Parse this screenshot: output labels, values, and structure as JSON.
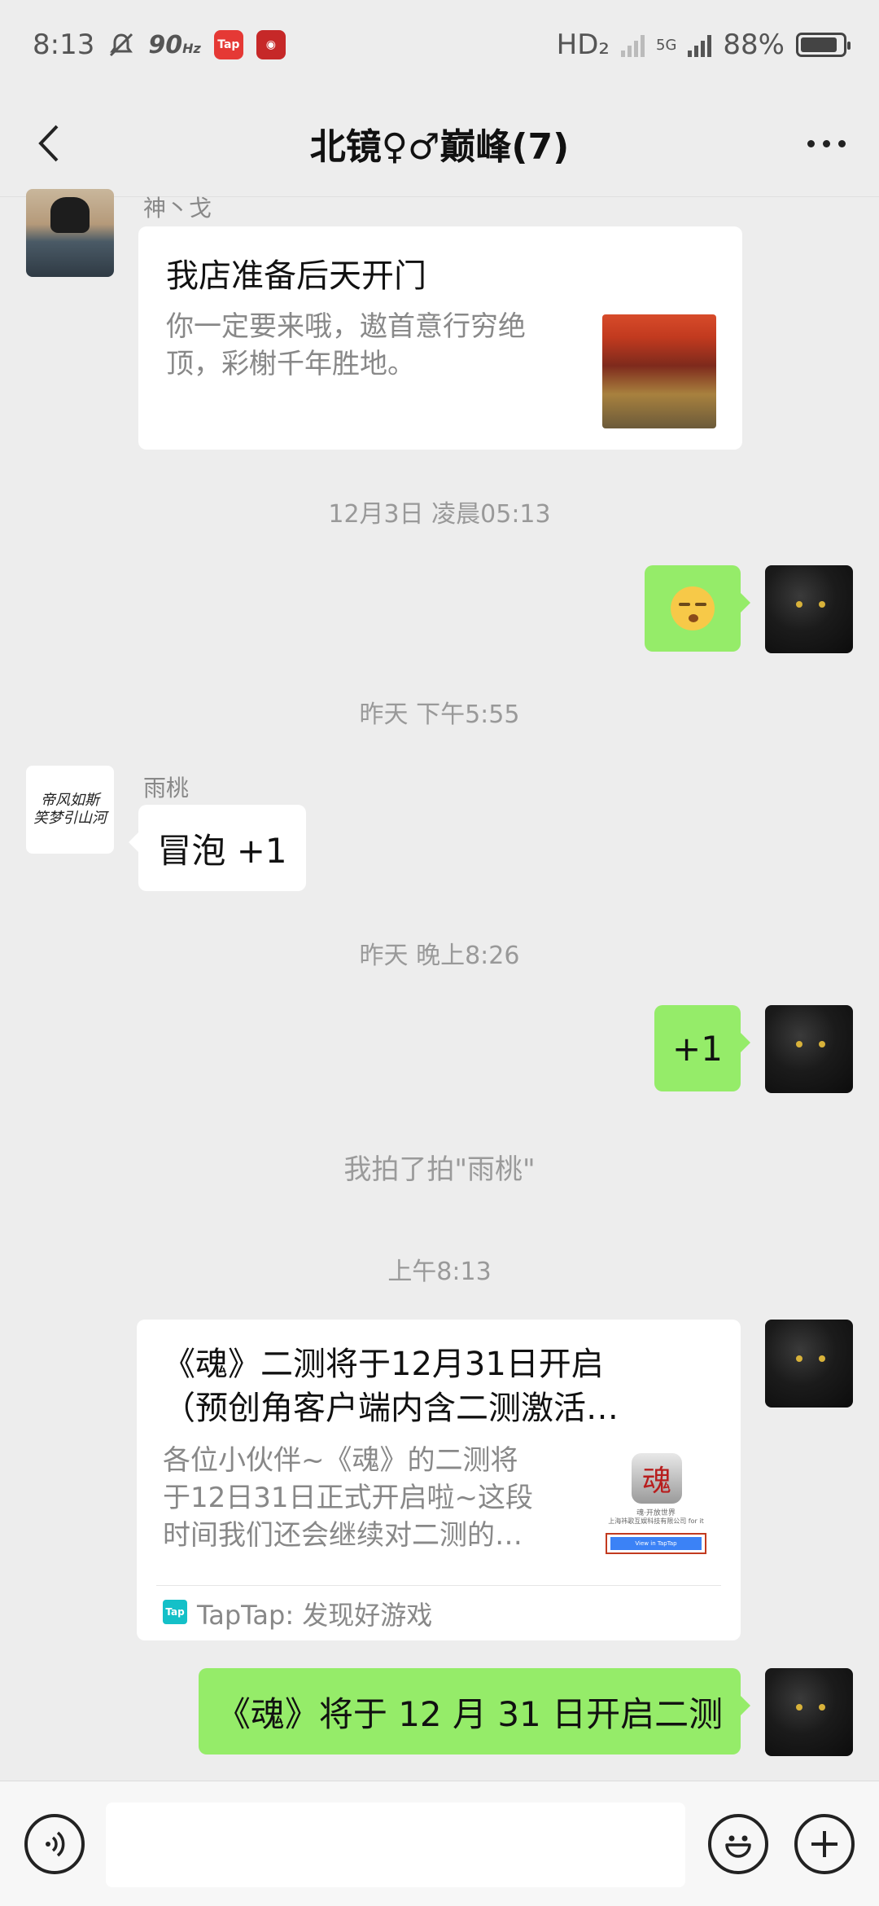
{
  "status_bar": {
    "time": "8:13",
    "refresh": "90",
    "refresh_unit": "Hz",
    "network_hd": "HD₂",
    "network_5g": "5G",
    "battery": "88%",
    "battery_level": 0.88
  },
  "header": {
    "title": "北镜♀♂巅峰(7)"
  },
  "messages": {
    "m1": {
      "sender": "神丶戈",
      "title": "我店准备后天开门",
      "desc_line1": "你一定要来哦，遨首意行穷绝",
      "desc_line2": "顶，彩榭千年胜地。"
    },
    "ts1": "12月3日 凌晨05:13",
    "ts2": "昨天 下午5:55",
    "m3": {
      "sender": "雨桃",
      "text": "冒泡 +1",
      "avatar_text_line1": "帝风如斯",
      "avatar_text_line2": "笑梦引山河"
    },
    "ts3": "昨天 晚上8:26",
    "m4": {
      "text": "+1"
    },
    "system": "我拍了拍\"雨桃\"",
    "ts4": "上午8:13",
    "m5": {
      "title_line1": "《魂》二测将于12月31日开启",
      "title_line2": "（预创角客户端内含二测激活…",
      "desc_line1": "各位小伙伴~《魂》的二测将",
      "desc_line2": "于12日31日正式开启啦~这段",
      "desc_line3": "时间我们还会继续对二测的…",
      "thumb_logo": "魂",
      "thumb_caption": "魂·开放世界",
      "thumb_company": "上海祎歌互娱科技有限公司 for it",
      "thumb_button": "View in TapTap",
      "source_icon": "Tap",
      "source": "TapTap: 发现好游戏"
    },
    "m6": {
      "text": "《魂》将于 12 月 31 日开启二测"
    }
  },
  "input": {
    "placeholder": ""
  },
  "colors": {
    "bubble_green": "#95ec69",
    "background": "#ededed",
    "taptap": "#14c0c8"
  }
}
